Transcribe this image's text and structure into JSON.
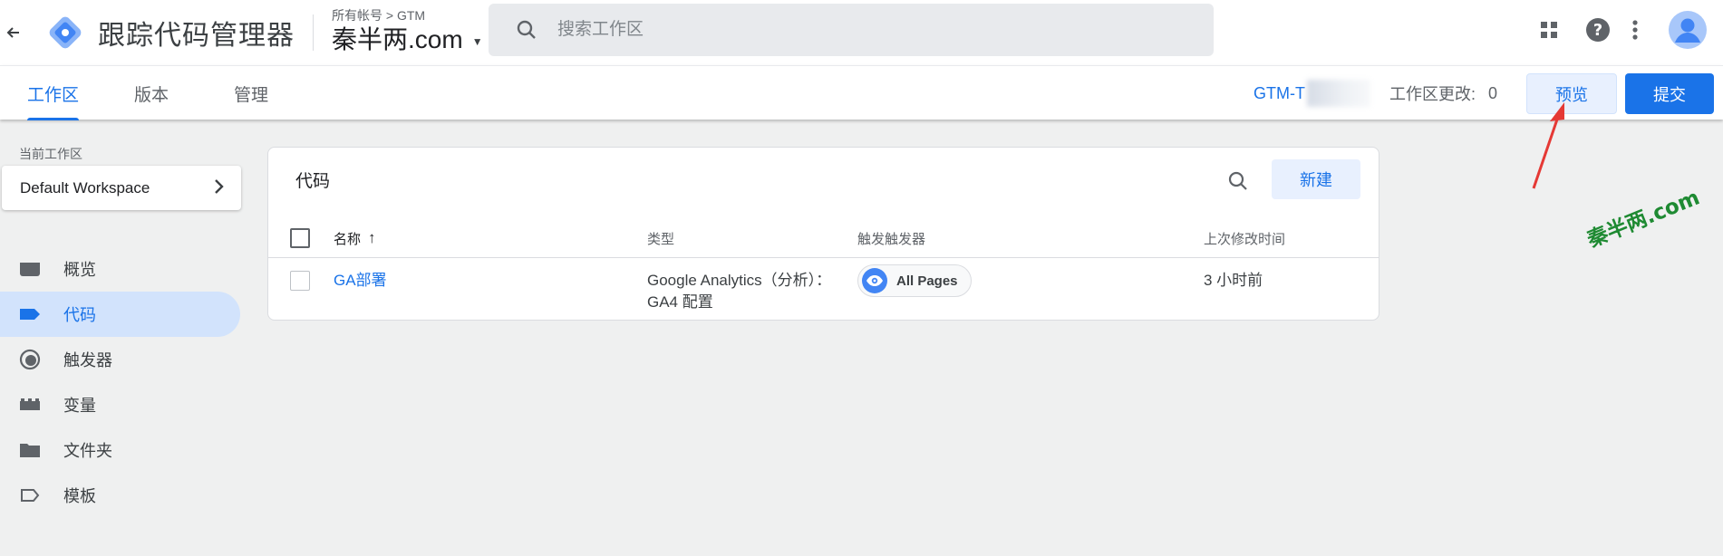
{
  "header": {
    "app_title": "跟踪代码管理器",
    "breadcrumb": "所有帐号 > GTM",
    "container_name": "秦半两.com",
    "search_placeholder": "搜索工作区"
  },
  "tabs": [
    {
      "label": "工作区",
      "active": true
    },
    {
      "label": "版本",
      "active": false
    },
    {
      "label": "管理",
      "active": false
    }
  ],
  "toolbar": {
    "container_id": "GTM-T",
    "changes_label": "工作区更改:",
    "changes_count": "0",
    "preview_label": "预览",
    "submit_label": "提交"
  },
  "sidebar": {
    "workspace_label": "当前工作区",
    "workspace_name": "Default Workspace",
    "items": [
      {
        "label": "概览",
        "icon": "overview-icon"
      },
      {
        "label": "代码",
        "icon": "tag-icon",
        "active": true
      },
      {
        "label": "触发器",
        "icon": "trigger-icon"
      },
      {
        "label": "变量",
        "icon": "variable-icon"
      },
      {
        "label": "文件夹",
        "icon": "folder-icon"
      },
      {
        "label": "模板",
        "icon": "template-icon"
      }
    ]
  },
  "tags_card": {
    "title": "代码",
    "new_label": "新建",
    "columns": [
      "名称",
      "类型",
      "触发触发器",
      "上次修改时间"
    ],
    "rows": [
      {
        "name": "GA部署",
        "type_line1": "Google Analytics（分析）：",
        "type_line2": "GA4 配置",
        "trigger": "All Pages",
        "modified": "3 小时前"
      }
    ]
  },
  "watermark": "秦半两.com",
  "colors": {
    "accent": "#1a73e8",
    "active_nav_bg": "#d2e3fc",
    "annotation_red": "#e53935",
    "watermark_green": "#1e8a32"
  }
}
